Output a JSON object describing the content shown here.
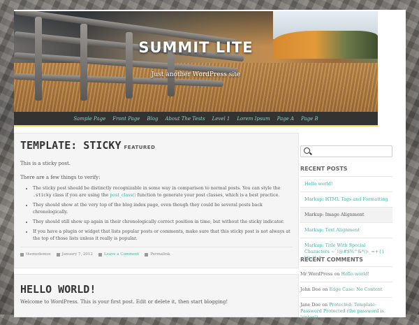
{
  "site": {
    "title": "SUMMIT LITE",
    "description": "Just another WordPress site"
  },
  "nav": {
    "items": [
      "Sample Page",
      "Front Page",
      "Blog",
      "About The Tests",
      "Level 1",
      "Lorem Ipsum",
      "Page A",
      "Page B"
    ]
  },
  "posts": [
    {
      "title": "TEMPLATE: STICKY",
      "badge": "FEATURED",
      "intro": "This is a sticky post.",
      "lead": "There are a few things to verify:",
      "bullets": [
        {
          "text_a": "The sticky post should be distinctly recognizable in some way in comparison to normal posts. You can style the ",
          "code": ".sticky",
          "text_b": " class if you are using the ",
          "link": "post_class()",
          "text_c": " function to generate your post classes, which is a best practice."
        },
        {
          "text": "They should show at the very top of the blog index page, even though they could be several posts back chronologically."
        },
        {
          "text": "They should still show up again in their chronologically correct position in time, but without the sticky indicator."
        },
        {
          "text": "If you have a plugin or widget that lists popular posts or comments, make sure that this sticky post is not always at the top of those lists unless it really is popular."
        }
      ],
      "meta": {
        "author": "themedemos",
        "date": "January 7, 2012",
        "comments": "Leave a Comment",
        "permalink": "Permalink"
      }
    },
    {
      "title": "HELLO WORLD!",
      "intro": "Welcome to WordPress. This is your first post. Edit or delete it, then start blogging!"
    }
  ],
  "sidebar": {
    "search_placeholder": "",
    "recent_posts_title": "RECENT POSTS",
    "recent_posts": [
      "Hello world!",
      "Markup: HTML Tags and Formatting",
      "Markup: Image Alignment",
      "Markup: Text Alignment",
      "Markup: Title With Special Characters ~`!@#$%^&*()-_=+{}[]/;:'\",.?"
    ],
    "active_index": 2,
    "recent_comments_title": "RECENT COMMENTS",
    "recent_comments": [
      {
        "author": "Mr WordPress",
        "on": " on ",
        "post": "Hello world!"
      },
      {
        "author": "John Doe",
        "on": " on ",
        "post": "Edge Case: No Content"
      },
      {
        "author": "Jane Doe",
        "on": " on ",
        "post": "Protected: Template: Password Protected (the password is \"enter\")"
      }
    ]
  },
  "colors": {
    "accent": "#4ab0a0",
    "nav_bg": "#333333",
    "nav_border": "#f0d85a"
  }
}
